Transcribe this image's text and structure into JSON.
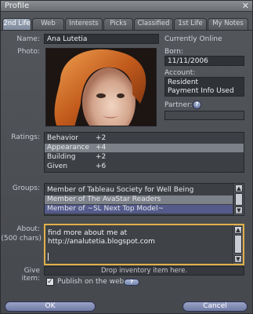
{
  "window": {
    "title": "Profile",
    "close_glyph": "✕"
  },
  "tabs": [
    {
      "label": "2nd Life",
      "active": true
    },
    {
      "label": "Web"
    },
    {
      "label": "Interests"
    },
    {
      "label": "Picks"
    },
    {
      "label": "Classified"
    },
    {
      "label": "1st Life"
    },
    {
      "label": "My Notes"
    }
  ],
  "profile": {
    "name_label": "Name:",
    "name_value": "Ana Lutetia",
    "photo_label": "Photo:",
    "online_status": "Currently Online",
    "born_label": "Born:",
    "born_value": "11/11/2006",
    "account_label": "Account:",
    "account_lines": [
      "Resident",
      "Payment Info Used"
    ],
    "partner_label": "Partner:",
    "partner_help": "?"
  },
  "ratings": {
    "label": "Ratings:",
    "rows": [
      {
        "name": "Behavior",
        "value": "+2"
      },
      {
        "name": "Appearance",
        "value": "+4"
      },
      {
        "name": "Building",
        "value": "+2"
      },
      {
        "name": "Given",
        "value": "+6"
      }
    ]
  },
  "groups": {
    "label": "Groups:",
    "rows": [
      "Member of Tableau Society for Well Being",
      "Member of The AvaStar Readers",
      "Member of ~SL Next Top Model~"
    ]
  },
  "about": {
    "label": "About:",
    "sublabel": "(500 chars)",
    "text": "find more about me at\nhttp://analutetia.blogspot.com"
  },
  "give_item": {
    "label": "Give item:",
    "dropzone_text": "Drop inventory item here."
  },
  "publish": {
    "checkbox_glyph": "✓",
    "label": "Publish on the web",
    "help": "?"
  },
  "buttons": {
    "ok": "OK",
    "cancel": "Cancel"
  },
  "icons": {
    "scroll_up": "▲",
    "scroll_down": "▼"
  },
  "colors": {
    "tab_active": "#8f9bac",
    "about_border": "#e1b04a",
    "row_selected": "#545a8a"
  }
}
